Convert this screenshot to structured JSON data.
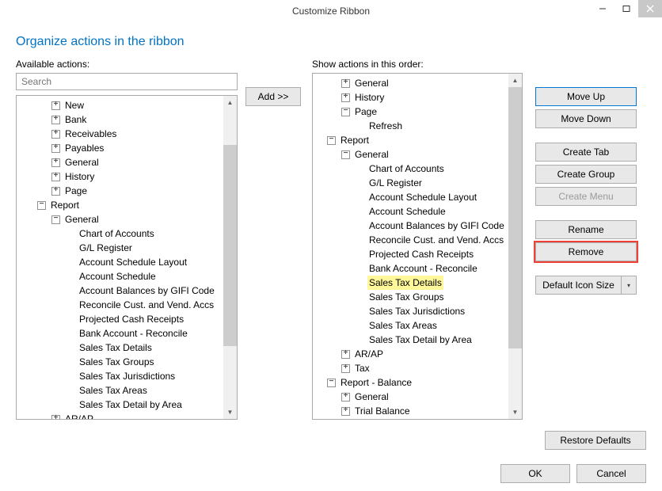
{
  "window": {
    "title": "Customize Ribbon",
    "minimize": "—",
    "maximize": "☐",
    "close": "✕"
  },
  "page_title": "Organize actions in the ribbon",
  "left": {
    "label": "Available actions:",
    "search_placeholder": "Search",
    "tree": [
      {
        "indent": 1,
        "exp": "+",
        "label": "New"
      },
      {
        "indent": 1,
        "exp": "+",
        "label": "Bank"
      },
      {
        "indent": 1,
        "exp": "+",
        "label": "Receivables"
      },
      {
        "indent": 1,
        "exp": "+",
        "label": "Payables"
      },
      {
        "indent": 1,
        "exp": "+",
        "label": "General"
      },
      {
        "indent": 1,
        "exp": "+",
        "label": "History"
      },
      {
        "indent": 1,
        "exp": "+",
        "label": "Page"
      },
      {
        "indent": 0,
        "exp": "-",
        "label": "Report"
      },
      {
        "indent": 1,
        "exp": "-",
        "label": "General"
      },
      {
        "indent": 2,
        "exp": "",
        "label": "Chart of Accounts"
      },
      {
        "indent": 2,
        "exp": "",
        "label": "G/L Register"
      },
      {
        "indent": 2,
        "exp": "",
        "label": "Account Schedule Layout"
      },
      {
        "indent": 2,
        "exp": "",
        "label": "Account Schedule"
      },
      {
        "indent": 2,
        "exp": "",
        "label": "Account Balances by GIFI Code"
      },
      {
        "indent": 2,
        "exp": "",
        "label": "Reconcile Cust. and Vend. Accs"
      },
      {
        "indent": 2,
        "exp": "",
        "label": "Projected Cash Receipts"
      },
      {
        "indent": 2,
        "exp": "",
        "label": "Bank Account - Reconcile"
      },
      {
        "indent": 2,
        "exp": "",
        "label": "Sales Tax Details"
      },
      {
        "indent": 2,
        "exp": "",
        "label": "Sales Tax Groups"
      },
      {
        "indent": 2,
        "exp": "",
        "label": "Sales Tax Jurisdictions"
      },
      {
        "indent": 2,
        "exp": "",
        "label": "Sales Tax Areas"
      },
      {
        "indent": 2,
        "exp": "",
        "label": "Sales Tax Detail by Area"
      },
      {
        "indent": 1,
        "exp": "+",
        "label": "AR/AP"
      }
    ]
  },
  "add_button": "Add >>",
  "right": {
    "label": "Show actions in this order:",
    "tree": [
      {
        "indent": 1,
        "exp": "+",
        "label": "General"
      },
      {
        "indent": 1,
        "exp": "+",
        "label": "History"
      },
      {
        "indent": 1,
        "exp": "-",
        "label": "Page"
      },
      {
        "indent": 2,
        "exp": "",
        "label": "Refresh"
      },
      {
        "indent": 0,
        "exp": "-",
        "label": "Report"
      },
      {
        "indent": 1,
        "exp": "-",
        "label": "General"
      },
      {
        "indent": 2,
        "exp": "",
        "label": "Chart of Accounts"
      },
      {
        "indent": 2,
        "exp": "",
        "label": "G/L Register"
      },
      {
        "indent": 2,
        "exp": "",
        "label": "Account Schedule Layout"
      },
      {
        "indent": 2,
        "exp": "",
        "label": "Account Schedule"
      },
      {
        "indent": 2,
        "exp": "",
        "label": "Account Balances by GIFI Code"
      },
      {
        "indent": 2,
        "exp": "",
        "label": "Reconcile Cust. and Vend. Accs"
      },
      {
        "indent": 2,
        "exp": "",
        "label": "Projected Cash Receipts"
      },
      {
        "indent": 2,
        "exp": "",
        "label": "Bank Account - Reconcile"
      },
      {
        "indent": 2,
        "exp": "",
        "label": "Sales Tax Details",
        "selected": true
      },
      {
        "indent": 2,
        "exp": "",
        "label": "Sales Tax Groups"
      },
      {
        "indent": 2,
        "exp": "",
        "label": "Sales Tax Jurisdictions"
      },
      {
        "indent": 2,
        "exp": "",
        "label": "Sales Tax Areas"
      },
      {
        "indent": 2,
        "exp": "",
        "label": "Sales Tax Detail by Area"
      },
      {
        "indent": 1,
        "exp": "+",
        "label": "AR/AP"
      },
      {
        "indent": 1,
        "exp": "+",
        "label": "Tax"
      },
      {
        "indent": 0,
        "exp": "-",
        "label": "Report - Balance"
      },
      {
        "indent": 1,
        "exp": "+",
        "label": "General"
      },
      {
        "indent": 1,
        "exp": "+",
        "label": "Trial Balance"
      }
    ]
  },
  "buttons": {
    "move_up": "Move Up",
    "move_down": "Move Down",
    "create_tab": "Create Tab",
    "create_group": "Create Group",
    "create_menu": "Create Menu",
    "rename": "Rename",
    "remove": "Remove",
    "icon_size": "Default Icon Size",
    "restore": "Restore Defaults",
    "ok": "OK",
    "cancel": "Cancel"
  }
}
